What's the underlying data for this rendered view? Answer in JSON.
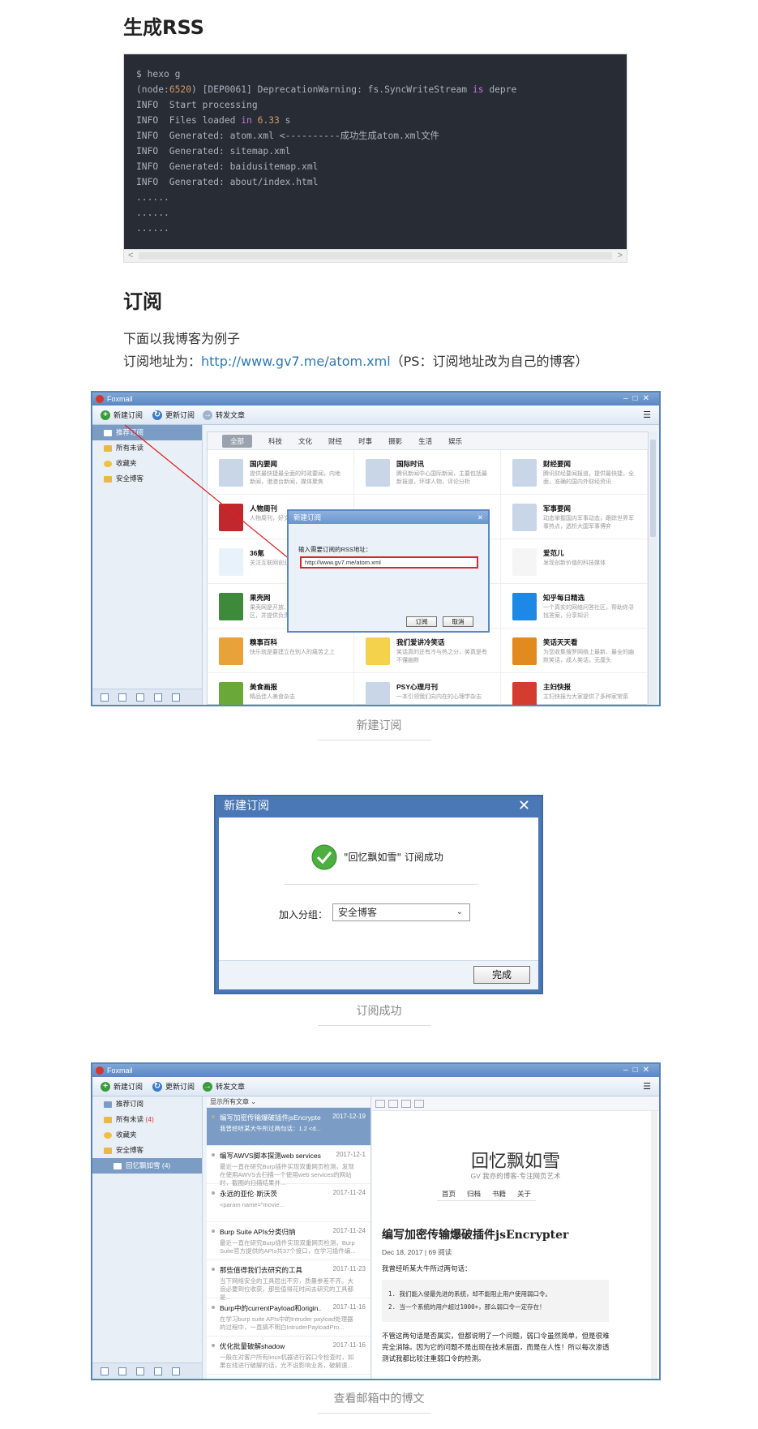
{
  "section1": {
    "heading": "生成RSS"
  },
  "code": {
    "line1": "$ hexo g",
    "line2_pre": "(node:",
    "line2_num": "6520",
    "line2_mid": ") [DEP0061] DeprecationWarning: fs.SyncWriteStream ",
    "line2_kw": "is",
    "line2_post": " depre",
    "line3": "INFO  Start processing",
    "line4_pre": "INFO  Files loaded ",
    "line4_kw": "in",
    "line4_sp": " ",
    "line4_num": "6.33",
    "line4_post": " s",
    "line5": "INFO  Generated: atom.xml <----------成功生成atom.xml文件",
    "line6": "INFO  Generated: sitemap.xml",
    "line7": "INFO  Generated: baidusitemap.xml",
    "line8": "INFO  Generated: about/index.html",
    "line9": "......",
    "line10": "......",
    "line11": "......",
    "scroll_left": "<",
    "scroll_right": ">"
  },
  "section2": {
    "heading": "订阅",
    "para1": "下面以我博客为例子",
    "para2_prefix": "订阅地址为：",
    "para2_link": "http://www.gv7.me/atom.xml",
    "para2_suffix": "（PS：订阅地址改为自己的博客）"
  },
  "foxmail": {
    "app_title": "Foxmail",
    "toolbar_new": "新建订阅",
    "toolbar_update": "更新订阅",
    "toolbar_forward": "转发文章",
    "sidebar": [
      "推荐订阅",
      "所有未读",
      "收藏夹",
      "安全博客"
    ],
    "tabs": [
      "全部",
      "科技",
      "文化",
      "财经",
      "时事",
      "摄影",
      "生活",
      "娱乐"
    ],
    "cards": [
      {
        "title": "国内要闻",
        "desc": "提供最快捷最全面的时政要闻，内地新闻，港澳台新闻，媒体聚焦",
        "color": "#c8d6e8"
      },
      {
        "title": "国际时讯",
        "desc": "腾讯新闻中心国际新闻，主要包括最新报道，环球人物，评论分析",
        "color": "#c8d6e8"
      },
      {
        "title": "财经要闻",
        "desc": "腾讯财经要闻报道，提供最快捷，全面，准确的国内外财经资讯",
        "color": "#c8d6e8"
      },
      {
        "title": "人物周刊",
        "desc": "人物周刊，好文章，好故事",
        "color": "#c0282d"
      },
      {
        "title": "",
        "desc": "",
        "color": "#ffffff"
      },
      {
        "title": "军事要闻",
        "desc": "动态掌握国内军事动态，跟踪世界军事热点，透析大国军事博弈",
        "color": "#c8d6e8"
      },
      {
        "title": "36氪",
        "desc": "关注互联网创业",
        "color": "#e8f2fb"
      },
      {
        "title": "",
        "desc": "",
        "color": "#ffffff"
      },
      {
        "title": "爱范儿",
        "desc": "发现创新价值的科技媒体",
        "color": "#f5f5f5"
      },
      {
        "title": "果壳网",
        "desc": "果壳网是开放、多元的泛科技兴趣社区，并提供负责任、有智趣的内容",
        "color": "#3c8a3a"
      },
      {
        "title": "",
        "desc": "",
        "color": "#ffffff"
      },
      {
        "title": "知乎每日精选",
        "desc": "一个真实的网络问答社区，帮助你寻找答案，分享知识",
        "color": "#1e88e5"
      },
      {
        "title": "糗事百科",
        "desc": "快乐就是要建立在别人的痛苦之上",
        "color": "#e7a23a"
      },
      {
        "title": "我们爱讲冷笑话",
        "desc": "笑话真的还有冷与热之分，笑真是有不懂幽默",
        "color": "#f4d24c"
      },
      {
        "title": "笑话天天看",
        "desc": "为您收集搜罗网络上最新、最全的幽默笑话，成人笑话，无厘头",
        "color": "#e28a1f"
      },
      {
        "title": "美食画报",
        "desc": "精品佳人美食杂志",
        "color": "#6aa83a"
      },
      {
        "title": "PSY心理月刊",
        "desc": "一本引领我们向内在的心理学杂志",
        "color": "#c8d6e8"
      },
      {
        "title": "主妇快报",
        "desc": "主妇快报为大家提供了多种家常菜",
        "color": "#d33c2e"
      }
    ],
    "dialog_title": "新建订阅",
    "dialog_prompt": "输入需要订阅的RSS地址：",
    "dialog_value": "http://www.gv7.me/atom.xml",
    "dialog_ok": "订阅",
    "dialog_cancel": "取消"
  },
  "caption1": "新建订阅",
  "success": {
    "title": "新建订阅",
    "message": "\"回忆飘如雪\" 订阅成功",
    "group_label": "加入分组：",
    "group_value": "安全博客",
    "done": "完成"
  },
  "caption2": "订阅成功",
  "reader": {
    "app_title": "Foxmail",
    "toolbar_new": "新建订阅",
    "toolbar_update": "更新订阅",
    "toolbar_forward": "转发文章",
    "sidebar": [
      "推荐订阅",
      "所有未读",
      "(4)",
      "收藏夹",
      "安全博客",
      "回忆飘如雪 (4)"
    ],
    "list_header": "显示所有文章 ⌄",
    "items": [
      {
        "title": "编写加密传输爆破插件jsEncrypter",
        "date": "2017-12-19",
        "preview": "我曾经听某大牛所过两句话：1.2 <d..."
      },
      {
        "title": "编写AWVS脚本探测web services",
        "date": "2017-12-1",
        "preview": "最近一直在研究Burp插件实现双重网页检测，发现在使用AWVS去扫描一个使用web services的网站时，截图的扫描结果并..."
      },
      {
        "title": "永远的亚伦·斯沃茨",
        "date": "2017-11-24",
        "preview": "<param name=\"movie..."
      },
      {
        "title": "Burp Suite APIs分类归纳",
        "date": "2017-11-24",
        "preview": "最近一直在研究Burp插件实现双重网页检测，Burp Suite官方提供的APIs共37个接口，在学习插件编..."
      },
      {
        "title": "那些值得我们去研究的工具",
        "date": "2017-11-23",
        "preview": "当下网络安全的工具层出不穷，质量参差不齐。大浪必要到位收获，那些值得花时间去研究的工具都是..."
      },
      {
        "title": "Burp中的currentPayload和origin...",
        "date": "2017-11-16",
        "preview": "在学习burp suite APIs中的Intruder payload处理器的过程中，一直搞不明白IntruderPayloadPro..."
      },
      {
        "title": "优化批量破解shadow",
        "date": "2017-11-16",
        "preview": "一般在对客户所有linux机器进行弱口令检查时，如果在线进行破解的话，光不说影响业务，破解速..."
      }
    ],
    "blog_title": "回忆飘如雪",
    "blog_subtitle": "GV 我亦的博客-专注网页艺术",
    "blog_nav": [
      "首页",
      "归档",
      "书籍",
      "关于"
    ],
    "post_title": "编写加密传输爆破插件jsEncrypter",
    "post_meta": "Dec 18, 2017 | 69 阅读",
    "post_intro": "我曾经听某大牛所过两句话：",
    "quote1": "1. 我们能入侵最先进的系统，却不能阻止用户使用弱口令。",
    "quote2": "2. 当一个系统的用户超过1000+，那么弱口令一定存在！",
    "post_body": "不管这两句话是否属实，但都说明了一个问题，弱口令虽然简单，但是很难完全消除。因为它的问题不是出现在技术层面，而是在人性！所以每次渗透测试我都比较注重弱口令的检测。"
  },
  "caption3": "查看邮箱中的博文"
}
